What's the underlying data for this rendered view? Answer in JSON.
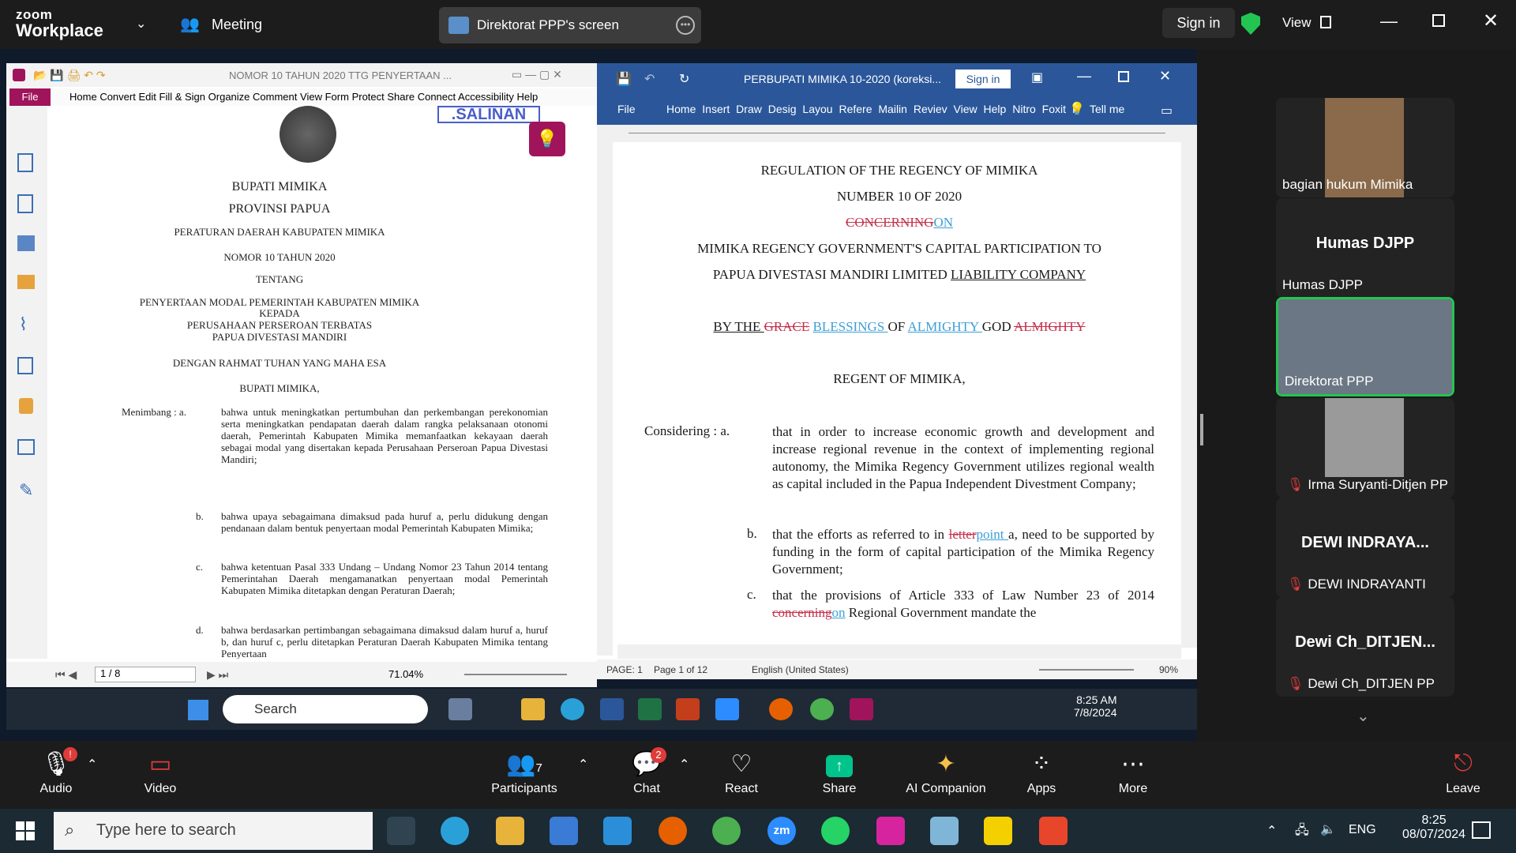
{
  "zoom": {
    "brand_top": "zoom",
    "brand_bottom": "Workplace",
    "meeting_label": "Meeting",
    "share_label": "Direktorat PPP's screen",
    "signin": "Sign in",
    "view": "View"
  },
  "pdf": {
    "title": "NOMOR 10 TAHUN 2020 TTG PENYERTAAN ...",
    "menu": [
      "File",
      "Home",
      "Convert",
      "Edit",
      "Fill & Sign",
      "Organize",
      "Comment",
      "View",
      "Form",
      "Protect",
      "Share",
      "Connect",
      "Accessibility",
      "Help"
    ],
    "stamp": ".SALINAN",
    "lines": {
      "l1": "BUPATI MIMIKA",
      "l2": "PROVINSI PAPUA",
      "l3": "PERATURAN DAERAH KABUPATEN MIMIKA",
      "l4": "NOMOR   10   TAHUN 2020",
      "l5": "TENTANG",
      "l6": "PENYERTAAN MODAL PEMERINTAH KABUPATEN MIMIKA",
      "l7": "KEPADA",
      "l8": "PERUSAHAAN PERSEROAN TERBATAS",
      "l9": "PAPUA DIVESTASI MANDIRI",
      "l10": "DENGAN RAHMAT TUHAN YANG MAHA ESA",
      "l11": "BUPATI MIMIKA,"
    },
    "menimbang": "Menimbang  : a.",
    "items": [
      {
        "k": "a.",
        "t": "bahwa untuk meningkatkan pertumbuhan dan perkembangan perekonomian serta meningkatkan pendapatan daerah dalam rangka pelaksanaan otonomi daerah, Pemerintah Kabupaten Mimika memanfaatkan kekayaan daerah sebagai modal yang disertakan kepada Perusahaan Perseroan Papua Divestasi Mandiri;"
      },
      {
        "k": "b.",
        "t": "bahwa upaya sebagaimana dimaksud pada huruf a, perlu didukung dengan pendanaan dalam bentuk penyertaan modal Pemerintah Kabupaten Mimika;"
      },
      {
        "k": "c.",
        "t": "bahwa ketentuan Pasal 333  Undang – Undang Nomor 23 Tahun 2014 tentang Pemerintahan Daerah mengamanatkan penyertaan modal Pemerintah Kabupaten Mimika ditetapkan dengan Peraturan Daerah;"
      },
      {
        "k": "d.",
        "t": "bahwa berdasarkan pertimbangan sebagaimana dimaksud dalam huruf a, huruf b, dan huruf c, perlu ditetapkan Peraturan Daerah Kabupaten Mimika tentang Penyertaan"
      }
    ],
    "page": "1 / 8",
    "zoom": "71.04%"
  },
  "word": {
    "title": "PERBUPATI MIMIKA 10-2020 (koreksi...",
    "signin": "Sign in",
    "tabs": [
      "File",
      "Home",
      "Insert",
      "Draw",
      "Desig",
      "Layou",
      "Refere",
      "Mailin",
      "Reviev",
      "View",
      "Help",
      "Nitro",
      "Foxit I"
    ],
    "tellme": "Tell me",
    "doc": {
      "t1": "REGULATION OF THE REGENCY OF MIMIKA",
      "t2": "NUMBER 10 OF 2020",
      "t3_del": "CONCERNING",
      "t3_ins": "ON",
      "t4": "MIMIKA REGENCY GOVERNMENT'S CAPITAL PARTICIPATION TO",
      "t5a": "PAPUA DIVESTASI MANDIRI LIMITED ",
      "t5b": "LIABILITY  COMPANY",
      "g1": "BY  THE ",
      "g_del1": "GRACE",
      "g_ins1": "BLESSINGS ",
      "g2": " OF ",
      "g_ins2": "ALMIGHTY ",
      "g3": " GOD  ",
      "g_del2": "ALMIGHTY",
      "regent": "REGENT OF MIMIKA,",
      "considering": "Considering : a.",
      "a": "that in order to  increase economic growth and development and increase regional revenue in the context of implementing regional autonomy, the Mimika Regency Government utilizes regional wealth as capital included in the Papua Independent Divestment Company;",
      "b_key": "b.",
      "b1": "that the efforts as referred to in ",
      "b_del": "letter",
      "b_ins": "point ",
      "b2": " a, need to be supported by funding in the form of capital participation of the Mimika Regency Government;",
      "c_key": "c.",
      "c1": "that the provisions of Article 333 of Law Number  23 of 2014 ",
      "c_del": "concerning",
      "c_ins": "on",
      "c2": " Regional Government mandate the"
    },
    "status": {
      "page": "PAGE: 1",
      "of": "Page 1 of 12",
      "lang": "English (United States)",
      "zoom": "90%"
    }
  },
  "inner_taskbar": {
    "search": "Search",
    "time": "8:25 AM",
    "date": "7/8/2024"
  },
  "gallery": [
    {
      "name": "bagian hukum Mimika"
    },
    {
      "header": "Humas DJPP",
      "name": "Humas DJPP"
    },
    {
      "name": "Direktorat PPP"
    },
    {
      "name": "Irma Suryanti-Ditjen PP"
    },
    {
      "header": "DEWI INDRAYA...",
      "name": "DEWI INDRAYANTI"
    },
    {
      "header": "Dewi  Ch_DITJEN...",
      "name": "Dewi Ch_DITJEN PP"
    }
  ],
  "toolbar": {
    "audio": "Audio",
    "video": "Video",
    "participants": "Participants",
    "participants_count": "7",
    "chat": "Chat",
    "chat_badge": "2",
    "react": "React",
    "share": "Share",
    "ai": "AI Companion",
    "apps": "Apps",
    "more": "More",
    "leave": "Leave",
    "audio_badge": "!"
  },
  "windows": {
    "search": "Type here to search",
    "lang": "ENG",
    "time": "8:25",
    "date": "08/07/2024"
  },
  "colors": {
    "word_blue": "#2b579a",
    "active_green": "#23c552",
    "zoom_bg": "#1c1c1c",
    "share_green": "#00c48c"
  }
}
